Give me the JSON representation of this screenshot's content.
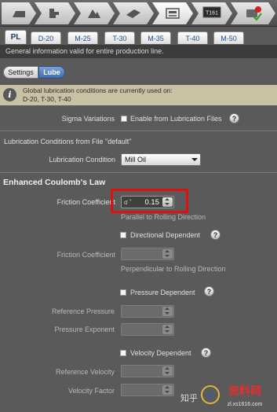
{
  "toolbar": {
    "steps": [
      "blank-icon",
      "process-chain-icon",
      "forming-icon",
      "tool-icon",
      "lubrication-icon",
      "monitor-icon",
      "run-icon"
    ],
    "active_step": 4,
    "monitor_label": "T161"
  },
  "tabs": [
    "PL",
    "D-20",
    "M-25",
    "T-30",
    "M-35",
    "T-40",
    "M-50"
  ],
  "active_tab": "PL",
  "general_info": "General information valid for entire production line.",
  "segments": {
    "settings": "Settings",
    "lube": "Lube"
  },
  "notice": {
    "line1": "Global lubrication conditions are currently used on:",
    "line2": "D-20, T-30, T-40"
  },
  "sigma": {
    "label": "Sigma Variations",
    "checkbox_label": "Enable from Lubrication Files"
  },
  "file_conditions": "Lubrication Conditions from File \"default\"",
  "lubrication_condition": {
    "label": "Lubrication Condition",
    "value": "Mill Oil"
  },
  "enhanced_title": "Enhanced Coulomb's Law",
  "friction_coefficient": {
    "label": "Friction Coefficient",
    "value": "0.15",
    "hint": "Parallel to Rolling Direction"
  },
  "directional": {
    "label": "Directional Dependent",
    "field_label": "Friction Coefficient",
    "hint": "Perpendicular to Rolling Direction"
  },
  "pressure": {
    "label": "Pressure Dependent",
    "ref_label": "Reference Pressure",
    "exp_label": "Pressure Exponent"
  },
  "velocity": {
    "label": "Velocity Dependent",
    "ref_label": "Reference Velocity",
    "factor_label": "Velocity Factor"
  },
  "colors": {
    "highlight": "#e01010",
    "accent": "#3f6bb0",
    "notice_bg": "#c9c1a4"
  },
  "watermark": {
    "text": "知乎",
    "logo_text": "资料网",
    "logo_sub": "zl.xs1616.com"
  }
}
